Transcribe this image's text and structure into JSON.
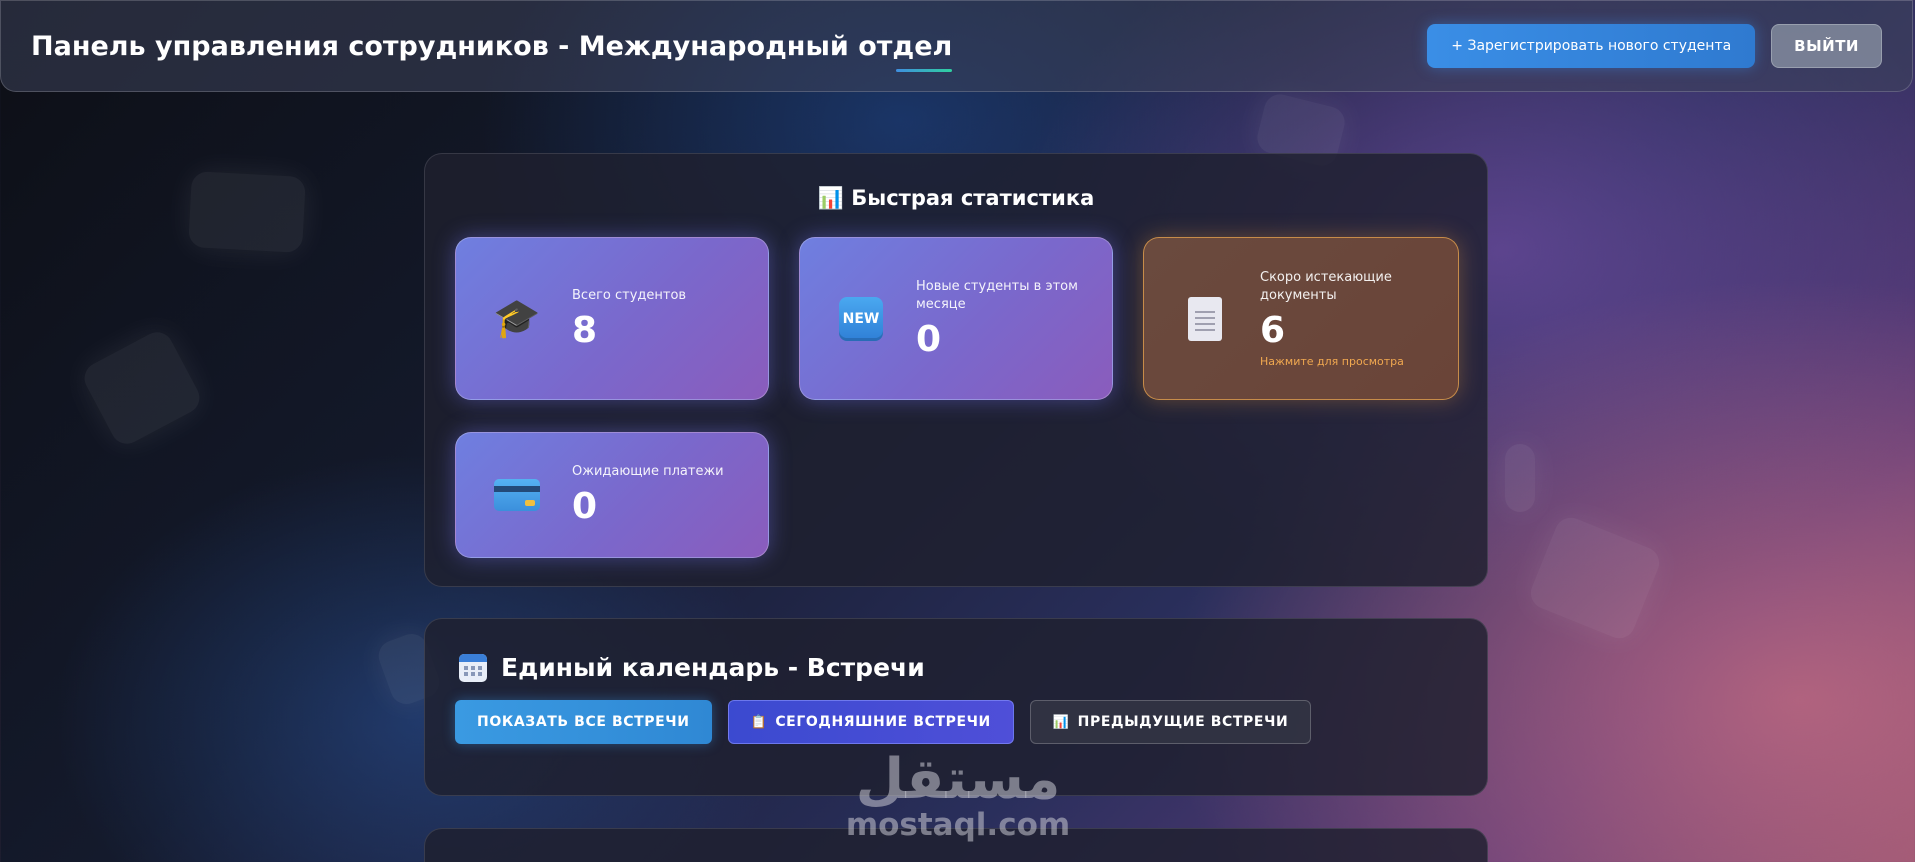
{
  "header": {
    "title": "Панель управления сотрудников - Международный отдел",
    "register_label": "+ Зарегистрировать нового студента",
    "logout_label": "ВЫЙТИ"
  },
  "stats": {
    "heading": "Быстрая статистика",
    "heading_icon": "📊",
    "cards": [
      {
        "icon": "graduation-cap-icon",
        "glyph": "🎓",
        "label": "Всего студентов",
        "value": "8"
      },
      {
        "icon": "new-badge-icon",
        "glyph": "NEW",
        "label": "Новые студенты в этом месяце",
        "value": "0"
      },
      {
        "icon": "document-icon",
        "label": "Скоро истекающие документы",
        "value": "6",
        "hint": "Нажмите для просмотра",
        "accent": "#f0a850"
      },
      {
        "icon": "credit-card-icon",
        "label": "Ожидающие платежи",
        "value": "0"
      }
    ]
  },
  "calendar": {
    "heading": "Единый календарь - Встречи",
    "buttons": {
      "all": "ПОКАЗАТЬ ВСЕ ВСТРЕЧИ",
      "today": "СЕГОДНЯШНИЕ ВСТРЕЧИ",
      "today_icon": "📋",
      "previous": "ПРЕДЫДУЩИЕ ВСТРЕЧИ",
      "previous_icon": "📊"
    }
  },
  "watermark": {
    "arabic": "مستقل",
    "latin": "mostaql.com"
  },
  "colors": {
    "accent_blue": "#3a8ee6",
    "card_purple": "#7a68cc",
    "warning_orange": "#f0a850"
  }
}
